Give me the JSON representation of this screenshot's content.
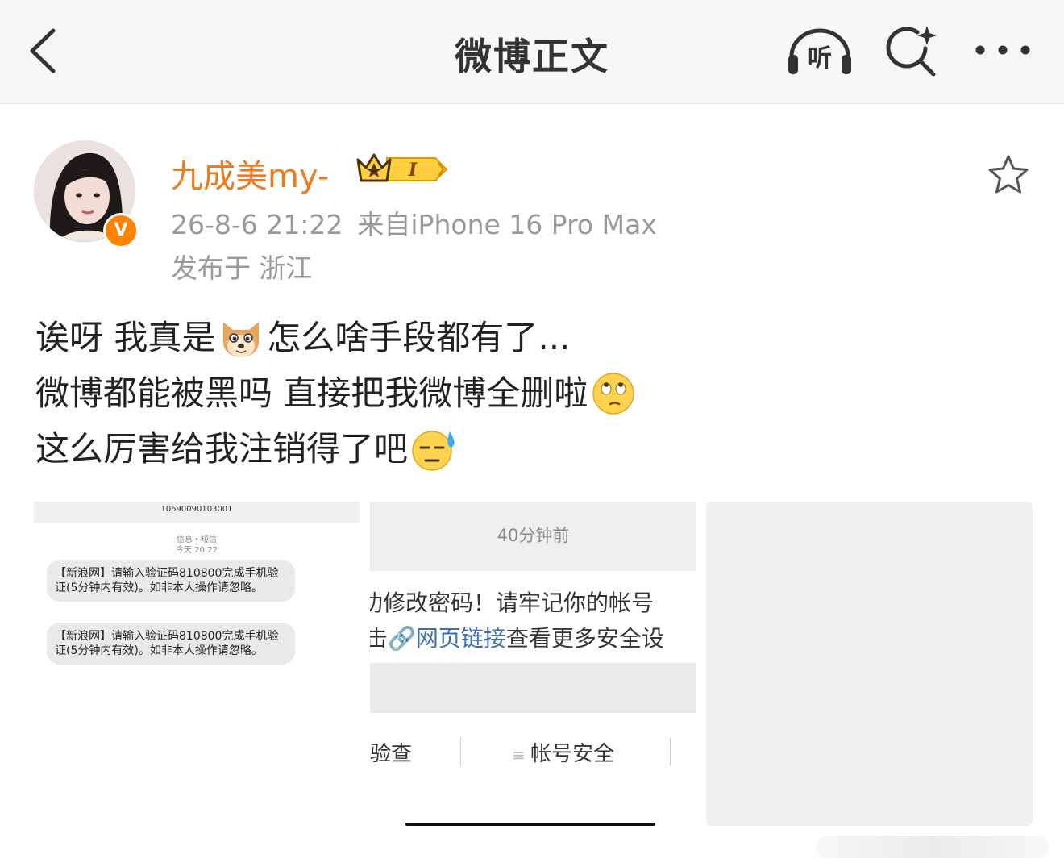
{
  "header": {
    "title": "微博正文",
    "back_icon": "chevron-left-icon",
    "listen_label": "听",
    "search_icon": "search-sparkle-icon",
    "more_icon": "more-dots-icon"
  },
  "author": {
    "name": "九成美my-",
    "badge_level": "I",
    "verified_mark": "V",
    "timestamp": "26-8-6 21:22",
    "source": "来自iPhone 16 Pro Max",
    "location": "发布于 浙江"
  },
  "post": {
    "line1_a": "诶呀 我真是",
    "line1_b": "怎么啥手段都有了...",
    "line2_a": "微博都能被黑吗 直接把我微博全删啦",
    "line3_a": "这么厉害给我注销得了吧"
  },
  "images": {
    "sms": {
      "sender": "10690090103001",
      "category": "信息・短信",
      "time": "今天 20:22",
      "message1": "【新浪网】请输入验证码810800完成手机验证(5分钟内有效)。如非本人操作请忽略。",
      "message2": "【新浪网】请输入验证码810800完成手机验证(5分钟内有效)。如非本人操作请忽略。"
    },
    "notice": {
      "time": "40分钟前",
      "line1": "功修改密码！请牢记你的帐号",
      "line2_prefix": "击",
      "link_text": "网页链接",
      "line2_suffix": "查看更多安全设",
      "action1": "验查",
      "action2": "帐号安全"
    }
  },
  "colors": {
    "accent": "#ee7a1c",
    "meta": "#9a9a9a",
    "link": "#3d6fb0",
    "verified": "#ff8200"
  }
}
